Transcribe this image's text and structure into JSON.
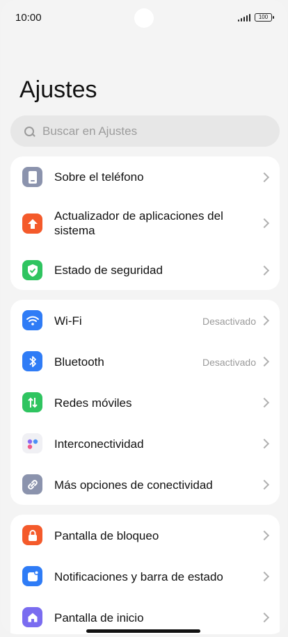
{
  "status_bar": {
    "time": "10:00",
    "battery": "100"
  },
  "page_title": "Ajustes",
  "search": {
    "placeholder": "Buscar en Ajustes"
  },
  "groups": [
    {
      "items": [
        {
          "label": "Sobre el teléfono",
          "icon": "phone-icon",
          "color": "#8b93ad"
        },
        {
          "label": "Actualizador de aplicaciones del sistema",
          "icon": "update-arrow-icon",
          "color": "#f45a2b"
        },
        {
          "label": "Estado de seguridad",
          "icon": "shield-check-icon",
          "color": "#2fc460"
        }
      ]
    },
    {
      "items": [
        {
          "label": "Wi-Fi",
          "value": "Desactivado",
          "icon": "wifi-icon",
          "color": "#2f7cf6"
        },
        {
          "label": "Bluetooth",
          "value": "Desactivado",
          "icon": "bluetooth-icon",
          "color": "#2f7cf6"
        },
        {
          "label": "Redes móviles",
          "icon": "mobile-data-icon",
          "color": "#2fc460"
        },
        {
          "label": "Interconectividad",
          "icon": "interconnect-icon",
          "color": "#f0f0f4"
        },
        {
          "label": "Más opciones de conectividad",
          "icon": "link-icon",
          "color": "#8b93ad"
        }
      ]
    },
    {
      "items": [
        {
          "label": "Pantalla de bloqueo",
          "icon": "lock-icon",
          "color": "#f45a2b"
        },
        {
          "label": "Notificaciones y barra de estado",
          "icon": "notification-icon",
          "color": "#2f7cf6"
        },
        {
          "label": "Pantalla de inicio",
          "icon": "home-icon",
          "color": "#7a6cf0"
        }
      ]
    }
  ]
}
